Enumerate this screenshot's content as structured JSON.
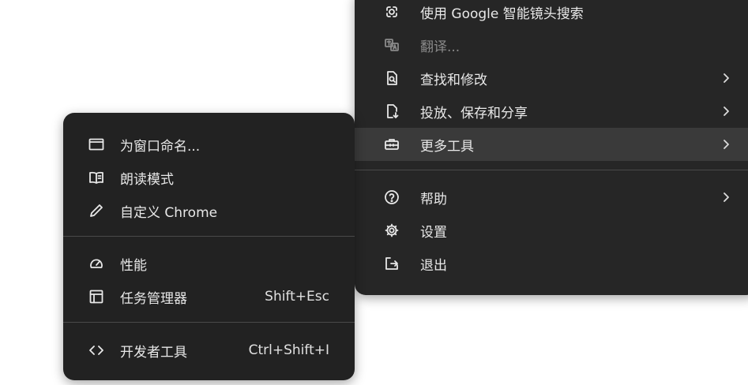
{
  "main_menu": {
    "items": [
      {
        "label": "使用 Google 智能镜头搜索",
        "icon": "google-lens-icon"
      },
      {
        "label": "翻译...",
        "icon": "translate-icon",
        "disabled": true
      },
      {
        "label": "查找和修改",
        "icon": "find-icon",
        "submenu": true
      },
      {
        "label": "投放、保存和分享",
        "icon": "cast-save-share-icon",
        "submenu": true
      },
      {
        "label": "更多工具",
        "icon": "toolbox-icon",
        "submenu": true,
        "highlighted": true
      },
      {
        "label": "帮助",
        "icon": "help-icon",
        "submenu": true
      },
      {
        "label": "设置",
        "icon": "settings-gear-icon"
      },
      {
        "label": "退出",
        "icon": "exit-icon"
      }
    ]
  },
  "submenu": {
    "items": [
      {
        "label": "为窗口命名...",
        "icon": "window-icon"
      },
      {
        "label": "朗读模式",
        "icon": "reading-book-icon"
      },
      {
        "label": "自定义 Chrome",
        "icon": "pencil-icon"
      },
      {
        "label": "性能",
        "icon": "gauge-icon"
      },
      {
        "label": "任务管理器",
        "icon": "task-manager-icon",
        "shortcut": "Shift+Esc"
      },
      {
        "label": "开发者工具",
        "icon": "code-brackets-icon",
        "shortcut": "Ctrl+Shift+I"
      }
    ]
  },
  "colors": {
    "menu_bg": "#262626",
    "submenu_bg": "#222222",
    "highlight": "#3a3a3a",
    "text": "#e8e8e8",
    "disabled_text": "#8a8a8a"
  }
}
